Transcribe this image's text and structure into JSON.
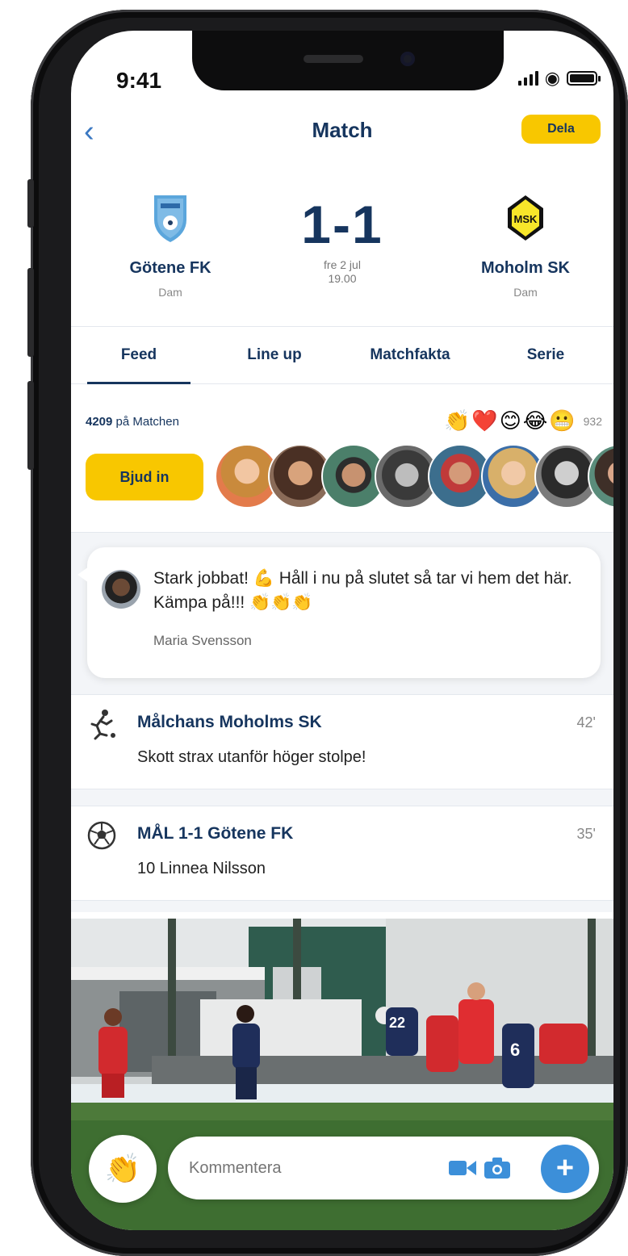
{
  "status_bar": {
    "time": "9:41"
  },
  "nav": {
    "back_icon": "chevron-left-icon",
    "title": "Match",
    "share_label": "Dela"
  },
  "match": {
    "home_team": {
      "name": "Götene FK",
      "category": "Dam"
    },
    "away_team": {
      "name": "Moholm SK",
      "category": "Dam"
    },
    "score": "1-1",
    "date": "fre 2 jul",
    "time": "19.00"
  },
  "tabs": [
    {
      "label": "Feed",
      "active": true
    },
    {
      "label": "Line up",
      "active": false
    },
    {
      "label": "Matchfakta",
      "active": false
    },
    {
      "label": "Serie",
      "active": false
    }
  ],
  "viewers": {
    "count": "4209",
    "label": "på Matchen",
    "reactions": [
      "👏",
      "❤️",
      "😊",
      "😂",
      "😬"
    ],
    "reaction_count": "932",
    "invite_label": "Bjud in"
  },
  "comment": {
    "text": "Stark jobbat! 💪 Håll i nu på slutet så tar vi hem det här. Kämpa på!!! 👏👏👏",
    "author": "Maria Svensson"
  },
  "events": [
    {
      "icon": "player-kick-icon",
      "title": "Målchans Moholms SK",
      "desc": "Skott strax utanför höger stolpe!",
      "minute": "42'"
    },
    {
      "icon": "soccer-ball-icon",
      "title": "MÅL 1-1 Götene FK",
      "desc": "10 Linnea Nilsson",
      "minute": "35'"
    }
  ],
  "composer": {
    "placeholder": "Kommentera",
    "clap": "👏",
    "plus": "+"
  },
  "colors": {
    "brand_yellow": "#f8c700",
    "navy": "#16355e",
    "accent_blue": "#3c8fd9"
  }
}
